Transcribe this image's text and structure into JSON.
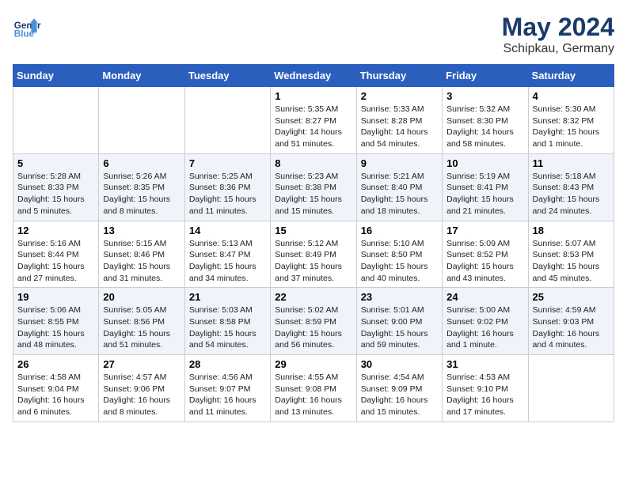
{
  "header": {
    "logo_line1": "General",
    "logo_line2": "Blue",
    "month_year": "May 2024",
    "location": "Schipkau, Germany"
  },
  "weekdays": [
    "Sunday",
    "Monday",
    "Tuesday",
    "Wednesday",
    "Thursday",
    "Friday",
    "Saturday"
  ],
  "weeks": [
    [
      {
        "day": "",
        "info": ""
      },
      {
        "day": "",
        "info": ""
      },
      {
        "day": "",
        "info": ""
      },
      {
        "day": "1",
        "info": "Sunrise: 5:35 AM\nSunset: 8:27 PM\nDaylight: 14 hours\nand 51 minutes."
      },
      {
        "day": "2",
        "info": "Sunrise: 5:33 AM\nSunset: 8:28 PM\nDaylight: 14 hours\nand 54 minutes."
      },
      {
        "day": "3",
        "info": "Sunrise: 5:32 AM\nSunset: 8:30 PM\nDaylight: 14 hours\nand 58 minutes."
      },
      {
        "day": "4",
        "info": "Sunrise: 5:30 AM\nSunset: 8:32 PM\nDaylight: 15 hours\nand 1 minute."
      }
    ],
    [
      {
        "day": "5",
        "info": "Sunrise: 5:28 AM\nSunset: 8:33 PM\nDaylight: 15 hours\nand 5 minutes."
      },
      {
        "day": "6",
        "info": "Sunrise: 5:26 AM\nSunset: 8:35 PM\nDaylight: 15 hours\nand 8 minutes."
      },
      {
        "day": "7",
        "info": "Sunrise: 5:25 AM\nSunset: 8:36 PM\nDaylight: 15 hours\nand 11 minutes."
      },
      {
        "day": "8",
        "info": "Sunrise: 5:23 AM\nSunset: 8:38 PM\nDaylight: 15 hours\nand 15 minutes."
      },
      {
        "day": "9",
        "info": "Sunrise: 5:21 AM\nSunset: 8:40 PM\nDaylight: 15 hours\nand 18 minutes."
      },
      {
        "day": "10",
        "info": "Sunrise: 5:19 AM\nSunset: 8:41 PM\nDaylight: 15 hours\nand 21 minutes."
      },
      {
        "day": "11",
        "info": "Sunrise: 5:18 AM\nSunset: 8:43 PM\nDaylight: 15 hours\nand 24 minutes."
      }
    ],
    [
      {
        "day": "12",
        "info": "Sunrise: 5:16 AM\nSunset: 8:44 PM\nDaylight: 15 hours\nand 27 minutes."
      },
      {
        "day": "13",
        "info": "Sunrise: 5:15 AM\nSunset: 8:46 PM\nDaylight: 15 hours\nand 31 minutes."
      },
      {
        "day": "14",
        "info": "Sunrise: 5:13 AM\nSunset: 8:47 PM\nDaylight: 15 hours\nand 34 minutes."
      },
      {
        "day": "15",
        "info": "Sunrise: 5:12 AM\nSunset: 8:49 PM\nDaylight: 15 hours\nand 37 minutes."
      },
      {
        "day": "16",
        "info": "Sunrise: 5:10 AM\nSunset: 8:50 PM\nDaylight: 15 hours\nand 40 minutes."
      },
      {
        "day": "17",
        "info": "Sunrise: 5:09 AM\nSunset: 8:52 PM\nDaylight: 15 hours\nand 43 minutes."
      },
      {
        "day": "18",
        "info": "Sunrise: 5:07 AM\nSunset: 8:53 PM\nDaylight: 15 hours\nand 45 minutes."
      }
    ],
    [
      {
        "day": "19",
        "info": "Sunrise: 5:06 AM\nSunset: 8:55 PM\nDaylight: 15 hours\nand 48 minutes."
      },
      {
        "day": "20",
        "info": "Sunrise: 5:05 AM\nSunset: 8:56 PM\nDaylight: 15 hours\nand 51 minutes."
      },
      {
        "day": "21",
        "info": "Sunrise: 5:03 AM\nSunset: 8:58 PM\nDaylight: 15 hours\nand 54 minutes."
      },
      {
        "day": "22",
        "info": "Sunrise: 5:02 AM\nSunset: 8:59 PM\nDaylight: 15 hours\nand 56 minutes."
      },
      {
        "day": "23",
        "info": "Sunrise: 5:01 AM\nSunset: 9:00 PM\nDaylight: 15 hours\nand 59 minutes."
      },
      {
        "day": "24",
        "info": "Sunrise: 5:00 AM\nSunset: 9:02 PM\nDaylight: 16 hours\nand 1 minute."
      },
      {
        "day": "25",
        "info": "Sunrise: 4:59 AM\nSunset: 9:03 PM\nDaylight: 16 hours\nand 4 minutes."
      }
    ],
    [
      {
        "day": "26",
        "info": "Sunrise: 4:58 AM\nSunset: 9:04 PM\nDaylight: 16 hours\nand 6 minutes."
      },
      {
        "day": "27",
        "info": "Sunrise: 4:57 AM\nSunset: 9:06 PM\nDaylight: 16 hours\nand 8 minutes."
      },
      {
        "day": "28",
        "info": "Sunrise: 4:56 AM\nSunset: 9:07 PM\nDaylight: 16 hours\nand 11 minutes."
      },
      {
        "day": "29",
        "info": "Sunrise: 4:55 AM\nSunset: 9:08 PM\nDaylight: 16 hours\nand 13 minutes."
      },
      {
        "day": "30",
        "info": "Sunrise: 4:54 AM\nSunset: 9:09 PM\nDaylight: 16 hours\nand 15 minutes."
      },
      {
        "day": "31",
        "info": "Sunrise: 4:53 AM\nSunset: 9:10 PM\nDaylight: 16 hours\nand 17 minutes."
      },
      {
        "day": "",
        "info": ""
      }
    ]
  ]
}
